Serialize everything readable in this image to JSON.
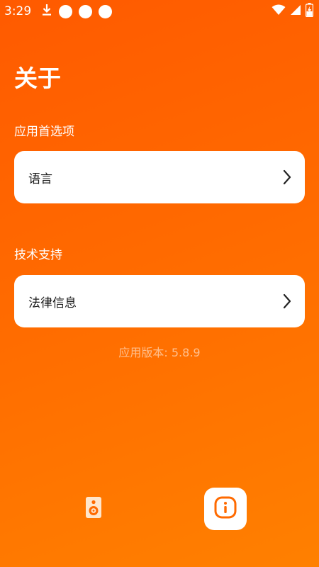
{
  "status_bar": {
    "time": "3:29",
    "icons": [
      "download-icon",
      "dot-icon",
      "dot-icon",
      "dot-icon",
      "wifi-icon",
      "signal-icon",
      "battery-charging-icon"
    ]
  },
  "page": {
    "title": "关于"
  },
  "sections": [
    {
      "label": "应用首选项",
      "items": [
        {
          "label": "语言",
          "icon": "chevron-right-icon"
        }
      ]
    },
    {
      "label": "技术支持",
      "items": [
        {
          "label": "法律信息",
          "icon": "chevron-right-icon"
        }
      ]
    }
  ],
  "version_text": "应用版本: 5.8.9",
  "bottom_nav": {
    "items": [
      {
        "icon": "speaker-icon",
        "active": false
      },
      {
        "icon": "info-icon",
        "active": true
      }
    ]
  },
  "colors": {
    "background_top": "#ff5a00",
    "background_bottom": "#ff8000",
    "card": "#ffffff",
    "accent": "#ff6a00"
  }
}
